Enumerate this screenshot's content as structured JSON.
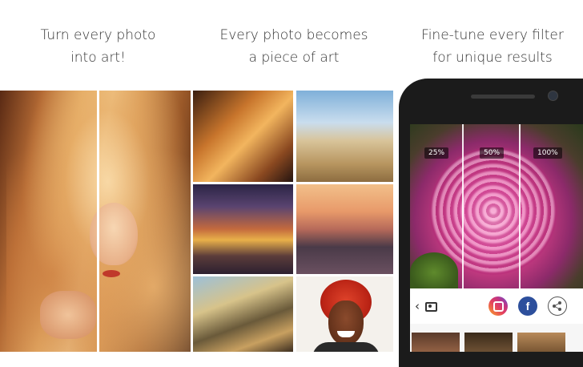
{
  "captions": {
    "left": [
      "Turn every photo",
      "into art!"
    ],
    "center": [
      "Every photo becomes",
      "a piece of art"
    ],
    "right": [
      "Fine-tune every filter",
      "for unique results"
    ]
  },
  "phone": {
    "strength_labels": [
      "25%",
      "50%",
      "100%"
    ],
    "toolbar": {
      "back_icon": "chevron-left-icon",
      "camera_icon": "camera-icon",
      "share_targets": [
        "instagram-icon",
        "facebook-icon",
        "share-icon"
      ],
      "facebook_glyph": "f"
    }
  },
  "colors": {
    "caption_text": "#333333",
    "phone_body": "#1b1b1b",
    "facebook": "#2d4f9c"
  }
}
